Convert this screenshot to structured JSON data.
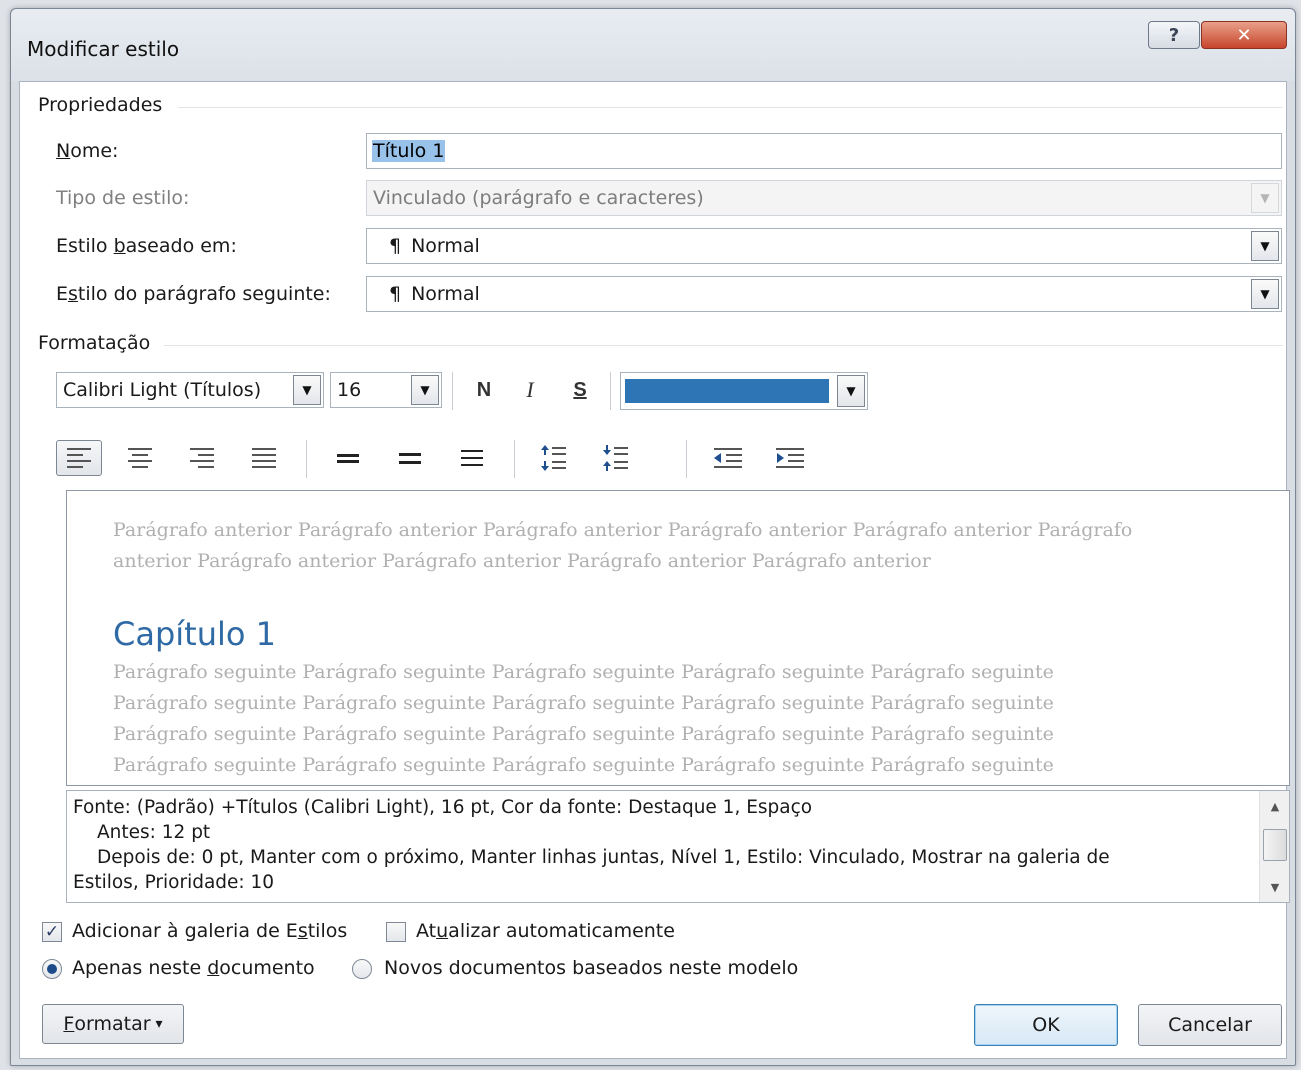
{
  "window": {
    "title": "Modificar estilo",
    "help_glyph": "?",
    "close_glyph": "✕"
  },
  "properties": {
    "section_label": "Propriedades",
    "name": {
      "label_pre": "",
      "label_u": "N",
      "label_post": "ome:",
      "value": "Título 1"
    },
    "style_type": {
      "label": "Tipo de estilo:",
      "value": "Vinculado (parágrafo e caracteres)"
    },
    "based_on": {
      "label_pre": "Estilo ",
      "label_u": "b",
      "label_post": "aseado em:",
      "value": "Normal"
    },
    "following": {
      "label_pre": "E",
      "label_u": "s",
      "label_post": "tilo do parágrafo seguinte:",
      "value": "Normal"
    },
    "pilcrow": "¶"
  },
  "formatting": {
    "section_label": "Formatação",
    "font": "Calibri Light (Títulos)",
    "size": "16",
    "bold": "N",
    "italic": "I",
    "underline": "S",
    "font_color": "#2e75b6"
  },
  "icons": {
    "align_left": "align-left-icon",
    "align_center": "align-center-icon",
    "align_right": "align-right-icon",
    "justify": "justify-icon",
    "single_spacing": "single-spacing-icon",
    "one_half_spacing": "one-half-spacing-icon",
    "double_spacing": "double-spacing-icon",
    "space_before": "increase-paragraph-spacing-icon",
    "space_after": "decrease-paragraph-spacing-icon",
    "decrease_indent": "decrease-indent-icon",
    "increase_indent": "increase-indent-icon"
  },
  "preview": {
    "previous_line1": "Parágrafo anterior Parágrafo anterior Parágrafo anterior Parágrafo anterior Parágrafo anterior Parágrafo",
    "previous_line2": "anterior Parágrafo anterior Parágrafo anterior Parágrafo anterior Parágrafo anterior",
    "heading": "Capítulo 1",
    "following_lines": [
      "Parágrafo seguinte Parágrafo seguinte Parágrafo seguinte Parágrafo seguinte Parágrafo seguinte",
      "Parágrafo seguinte Parágrafo seguinte Parágrafo seguinte Parágrafo seguinte Parágrafo seguinte",
      "Parágrafo seguinte Parágrafo seguinte Parágrafo seguinte Parágrafo seguinte Parágrafo seguinte",
      "Parágrafo seguinte Parágrafo seguinte Parágrafo seguinte Parágrafo seguinte Parágrafo seguinte"
    ]
  },
  "description": {
    "line1": "Fonte: (Padrão) +Títulos (Calibri Light), 16 pt, Cor da fonte: Destaque 1, Espaço",
    "line2": "Antes:  12 pt",
    "line3": "Depois de:  0 pt, Manter com o próximo, Manter linhas juntas, Nível 1, Estilo: Vinculado, Mostrar na galeria de",
    "line4": "Estilos, Prioridade: 10"
  },
  "options": {
    "add_to_gallery": {
      "label_pre": "Adicionar à galeria de E",
      "label_u": "s",
      "label_post": "tilos",
      "checked": true
    },
    "auto_update": {
      "label_pre": "At",
      "label_u": "u",
      "label_post": "alizar automaticamente",
      "checked": false
    },
    "only_this_doc": {
      "label_pre": "Apenas neste ",
      "label_u": "d",
      "label_post": "ocumento",
      "selected": true
    },
    "new_docs": {
      "label": "Novos documentos baseados neste modelo",
      "selected": false
    },
    "check_glyph": "✓"
  },
  "buttons": {
    "format_u": "F",
    "format_post": "ormatar",
    "format_caret": "▾",
    "ok": "OK",
    "cancel": "Cancelar"
  }
}
